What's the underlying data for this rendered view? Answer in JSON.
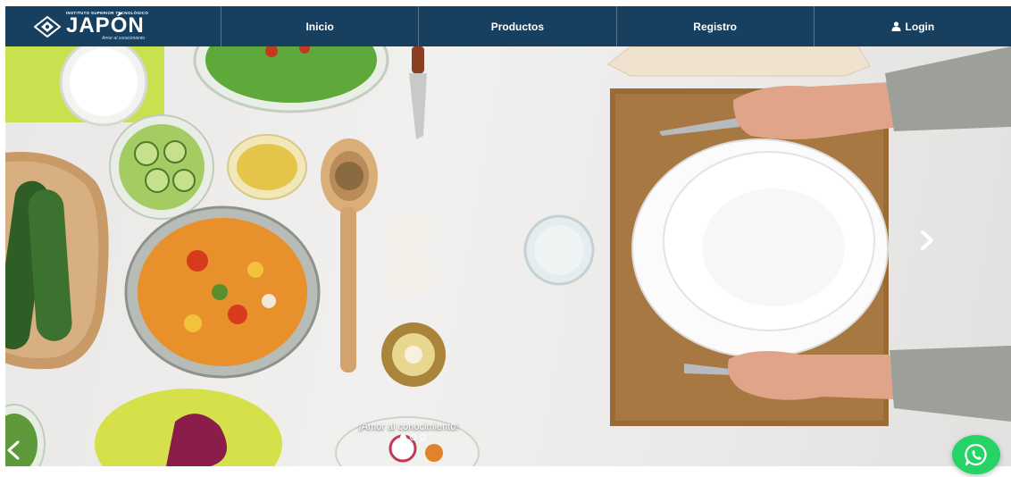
{
  "brand": {
    "institute": "INSTITUTO SUPERIOR TECNOLÓGICO",
    "name": "JAPÓN",
    "tagline": "Amor al conocimiento"
  },
  "nav": {
    "items": [
      {
        "label": "Inicio"
      },
      {
        "label": "Productos"
      },
      {
        "label": "Registro"
      },
      {
        "label": "Login",
        "icon": "user-icon"
      }
    ]
  },
  "carousel": {
    "caption": "¡Amor al conocimiento!",
    "slides_total": 3,
    "active_slide": 1
  },
  "colors": {
    "navbar": "#173f5f",
    "whatsapp": "#25d366"
  }
}
